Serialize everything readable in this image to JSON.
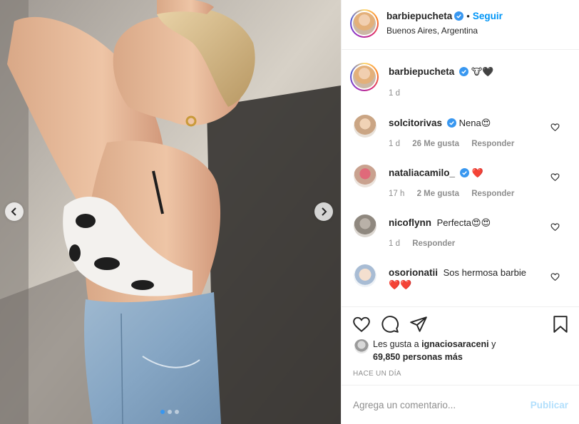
{
  "post": {
    "author": "barbiepucheta",
    "follow_label": "Seguir",
    "separator": "•",
    "location": "Buenos Aires, Argentina",
    "more_icon": "ellipsis-icon"
  },
  "caption": {
    "username": "barbiepucheta",
    "text": "🐮🖤",
    "time": "1 d"
  },
  "comments": [
    {
      "username": "solcitorivas",
      "verified": true,
      "text": "Nena😍",
      "time": "1 d",
      "likes": "26 Me gusta",
      "reply": "Responder"
    },
    {
      "username": "nataliacamilo_",
      "verified": true,
      "text": "❤️",
      "time": "17 h",
      "likes": "2 Me gusta",
      "reply": "Responder"
    },
    {
      "username": "nicoflynn",
      "verified": false,
      "text": "Perfecta😍😍",
      "time": "1 d",
      "likes": "",
      "reply": "Responder"
    },
    {
      "username": "osorionatii",
      "verified": false,
      "text": "Sos hermosa barbie",
      "text2": "❤️❤️"
    }
  ],
  "likes": {
    "prefix": "Les gusta a",
    "user": "ignaciosaraceni",
    "suffix": "y",
    "count": "69,850 personas más"
  },
  "timestamp": "HACE UN DÍA",
  "comment_box": {
    "placeholder": "Agrega un comentario...",
    "publish_label": "Publicar"
  },
  "carousel": {
    "dot_count": 3,
    "active_dot": 0
  },
  "colors": {
    "accent": "#0095f6",
    "verified": "#3897f0",
    "muted": "#8e8e8e",
    "heart": "#ed4956"
  },
  "icons": [
    "chevron-left-icon",
    "chevron-right-icon",
    "heart-icon",
    "comment-icon",
    "share-icon",
    "bookmark-icon",
    "verified-badge-icon"
  ]
}
